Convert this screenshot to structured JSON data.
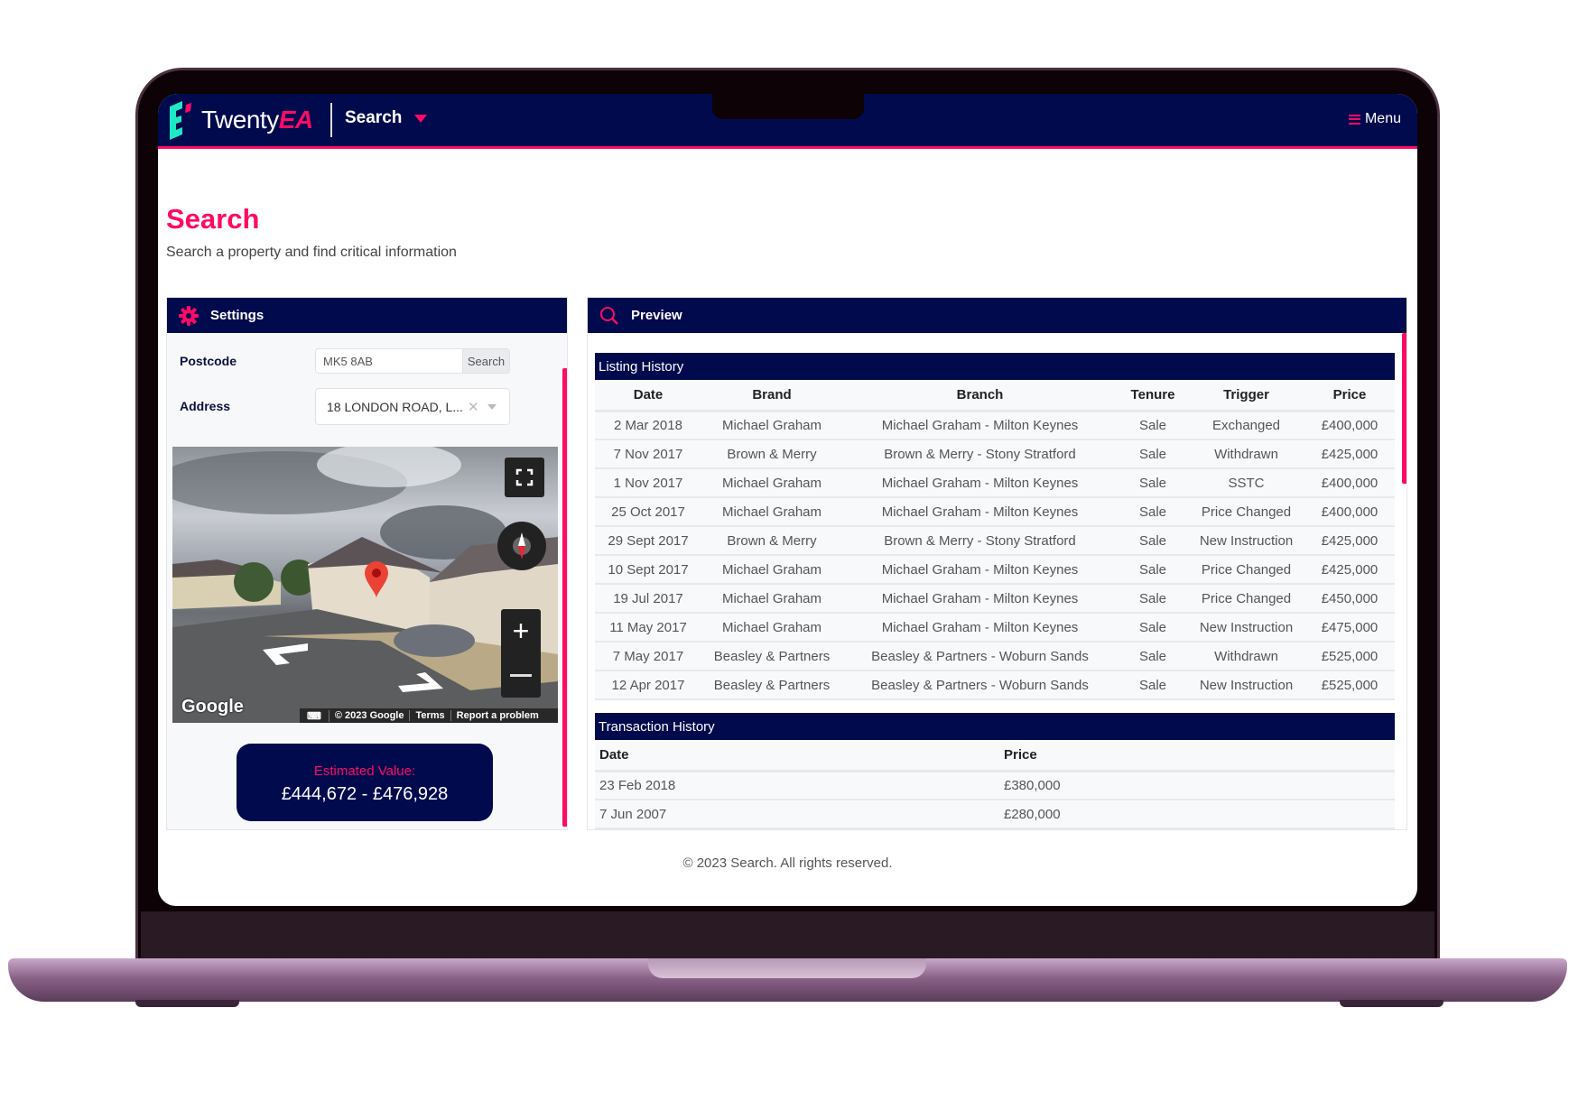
{
  "header": {
    "logo_text": "Twenty",
    "logo_accent": "EA",
    "nav_label": "Search",
    "menu_label": "Menu"
  },
  "page": {
    "title": "Search",
    "subtitle": "Search a property and find critical information"
  },
  "settings": {
    "title": "Settings",
    "postcode_label": "Postcode",
    "postcode_value": "MK5 8AB",
    "search_button": "Search",
    "address_label": "Address",
    "address_value": "18 LONDON ROAD, L...",
    "map": {
      "google_logo": "Google",
      "copyright": "© 2023 Google",
      "terms": "Terms",
      "report": "Report a problem"
    },
    "estimate_label": "Estimated Value:",
    "estimate_value": "£444,672 - £476,928"
  },
  "preview": {
    "title": "Preview",
    "listing": {
      "title": "Listing History",
      "columns": [
        "Date",
        "Brand",
        "Branch",
        "Tenure",
        "Trigger",
        "Price"
      ],
      "rows": [
        [
          "2 Mar 2018",
          "Michael Graham",
          "Michael Graham - Milton Keynes",
          "Sale",
          "Exchanged",
          "£400,000"
        ],
        [
          "7 Nov 2017",
          "Brown & Merry",
          "Brown & Merry - Stony Stratford",
          "Sale",
          "Withdrawn",
          "£425,000"
        ],
        [
          "1 Nov 2017",
          "Michael Graham",
          "Michael Graham - Milton Keynes",
          "Sale",
          "SSTC",
          "£400,000"
        ],
        [
          "25 Oct 2017",
          "Michael Graham",
          "Michael Graham - Milton Keynes",
          "Sale",
          "Price Changed",
          "£400,000"
        ],
        [
          "29 Sept 2017",
          "Brown & Merry",
          "Brown & Merry - Stony Stratford",
          "Sale",
          "New Instruction",
          "£425,000"
        ],
        [
          "10 Sept 2017",
          "Michael Graham",
          "Michael Graham - Milton Keynes",
          "Sale",
          "Price Changed",
          "£425,000"
        ],
        [
          "19 Jul 2017",
          "Michael Graham",
          "Michael Graham - Milton Keynes",
          "Sale",
          "Price Changed",
          "£450,000"
        ],
        [
          "11 May 2017",
          "Michael Graham",
          "Michael Graham - Milton Keynes",
          "Sale",
          "New Instruction",
          "£475,000"
        ],
        [
          "7 May 2017",
          "Beasley & Partners",
          "Beasley & Partners - Woburn Sands",
          "Sale",
          "Withdrawn",
          "£525,000"
        ],
        [
          "12 Apr 2017",
          "Beasley & Partners",
          "Beasley & Partners - Woburn Sands",
          "Sale",
          "New Instruction",
          "£525,000"
        ]
      ]
    },
    "transactions": {
      "title": "Transaction History",
      "columns": [
        "Date",
        "Price"
      ],
      "rows": [
        [
          "23 Feb 2018",
          "£380,000"
        ],
        [
          "7 Jun 2007",
          "£280,000"
        ]
      ]
    }
  },
  "footer": "© 2023 Search. All rights reserved.",
  "colors": {
    "navy": "#000a4d",
    "accent": "#ff0a64",
    "logo_teal": "#1de9c4"
  }
}
